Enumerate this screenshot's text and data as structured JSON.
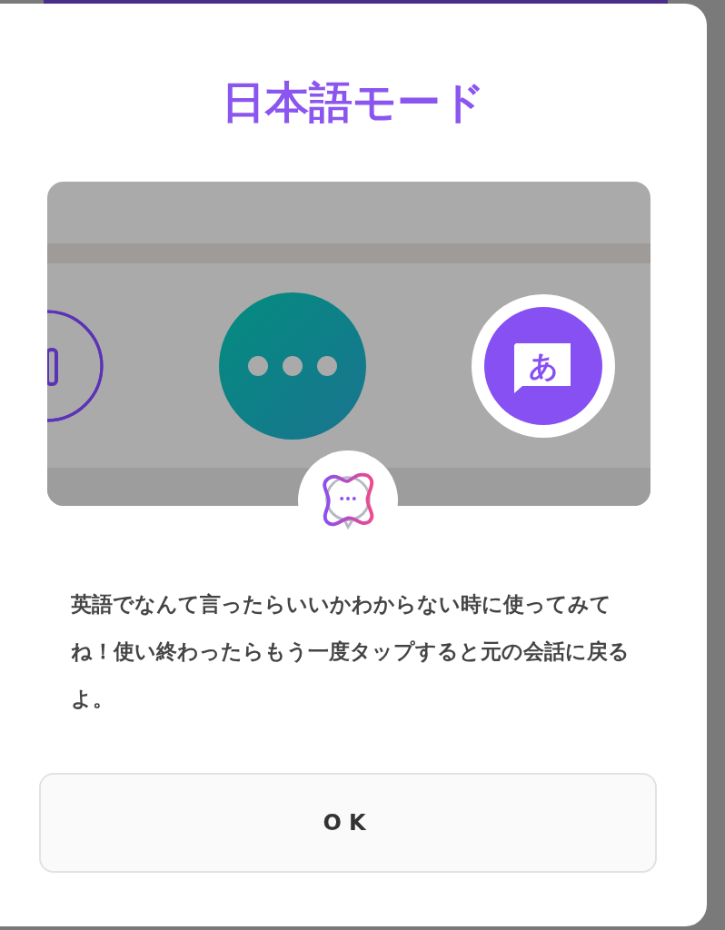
{
  "dialog": {
    "title": "日本語モード",
    "illustration": {
      "mode_glyph": "あ"
    },
    "message": "英語でなんて言ったらいいかわからない時に使ってみてね！使い終わったらもう一度タップすると元の会話に戻るよ。",
    "button": {
      "label": "OK"
    }
  }
}
